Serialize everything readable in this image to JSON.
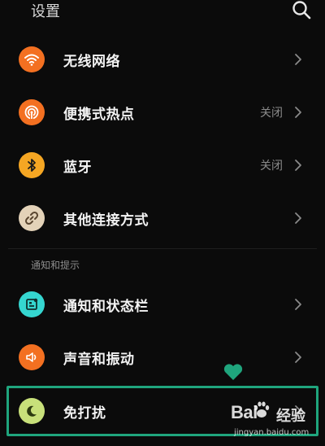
{
  "header": {
    "title": "设置",
    "search_icon": "search-icon"
  },
  "rows": [
    {
      "label": "无线网络",
      "value": "",
      "icon": "wifi-icon",
      "icon_color": "#f37021"
    },
    {
      "label": "便携式热点",
      "value": "关闭",
      "icon": "hotspot-icon",
      "icon_color": "#f37021"
    },
    {
      "label": "蓝牙",
      "value": "关闭",
      "icon": "bluetooth-icon",
      "icon_color": "#f5a623"
    },
    {
      "label": "其他连接方式",
      "value": "",
      "icon": "link-icon",
      "icon_color": "#e3d2b8"
    }
  ],
  "section": {
    "label": "通知和提示"
  },
  "rows2": [
    {
      "label": "通知和状态栏",
      "value": "",
      "icon": "notification-icon",
      "icon_color": "#35d6d0"
    },
    {
      "label": "声音和振动",
      "value": "",
      "icon": "speaker-icon",
      "icon_color": "#f37021"
    },
    {
      "label": "免打扰",
      "value": "",
      "icon": "moon-icon",
      "icon_color": "#c8e07a"
    }
  ],
  "annotation": {
    "highlight_color": "#1fa57d",
    "heart_icon": "heart-icon"
  },
  "watermark": {
    "logo": "Bai",
    "brand": "经验",
    "url": "jingyan.baidu.com"
  }
}
